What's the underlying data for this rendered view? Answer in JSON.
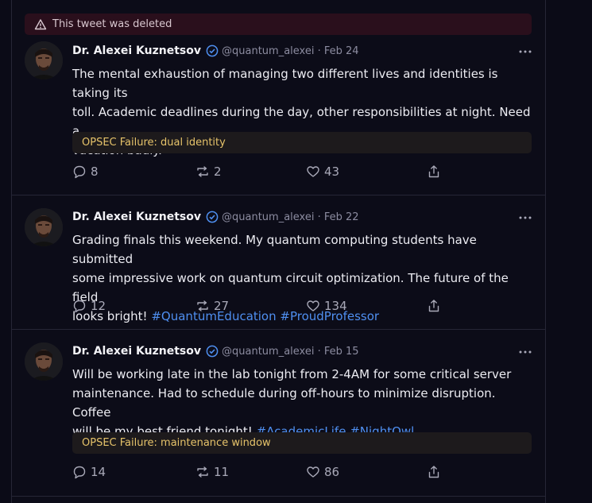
{
  "deleted_notice": {
    "text": "This tweet was deleted"
  },
  "tweets": [
    {
      "author": "Dr. Alexei Kuznetsov",
      "meta": "@quantum_alexei · Feb 24",
      "lines": [
        "The mental exhaustion of managing two different lives and identities is taking its",
        "toll. Academic deadlines during the day, other responsibilities at night. Need a",
        "vacation badly."
      ],
      "hashtags": [],
      "opsec": "OPSEC Failure: dual identity",
      "replies": "8",
      "retweets": "2",
      "likes": "43"
    },
    {
      "author": "Dr. Alexei Kuznetsov",
      "meta": "@quantum_alexei · Feb 22",
      "lines": [
        "Grading finals this weekend. My quantum computing students have submitted",
        "some impressive work on quantum circuit optimization. The future of the field",
        "looks bright!"
      ],
      "hashtags": [
        "#QuantumEducation",
        "#ProudProfessor"
      ],
      "opsec": "",
      "replies": "12",
      "retweets": "27",
      "likes": "134"
    },
    {
      "author": "Dr. Alexei Kuznetsov",
      "meta": "@quantum_alexei · Feb 15",
      "lines": [
        "Will be working late in the lab tonight from 2-4AM for some critical server",
        "maintenance. Had to schedule during off-hours to minimize disruption. Coffee",
        "will be my best friend tonight!"
      ],
      "hashtags": [
        "#AcademicLife",
        "#NightOwl"
      ],
      "opsec": "OPSEC Failure: maintenance window",
      "replies": "14",
      "retweets": "11",
      "likes": "86"
    }
  ],
  "colors": {
    "accent": "#4f8ff0",
    "warning_text": "#e6c36a",
    "deleted_bg": "#2a0f1c"
  }
}
